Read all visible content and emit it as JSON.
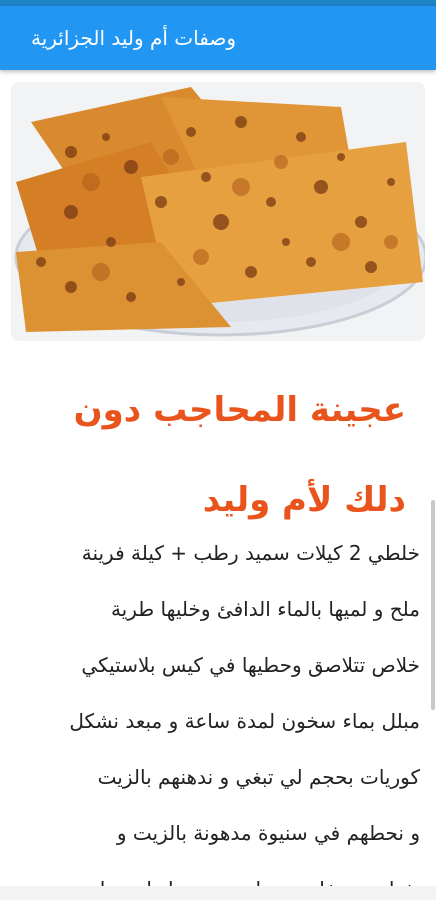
{
  "app_bar": {
    "title": "وصفات أم وليد الجزائرية",
    "color": "#2196f3"
  },
  "recipe": {
    "image_alt_icon": "msemen-photo",
    "title": "عجينة المحاجب دون دلك لأم وليد",
    "title_color": "#e8541c",
    "body_lines": [
      "خلطي 2 كيلات سميد رطب + كيلة فرينة",
      "ملح و لميها بالماء الدافئ وخليها طرية",
      "خلاص تتلاصق وحطيها في كيس بلاستيكي",
      "مبلل بماء سخون لمدة ساعة و مبعد نشكل",
      "كوريات بحجم لي تبغي و ندهنهم بالزيت",
      "و نحطهم في سنيوة مدهونة بالزيت و",
      "نغطيهم ونخليهم يرتاحو ومبعد ابداي تحلي"
    ]
  }
}
